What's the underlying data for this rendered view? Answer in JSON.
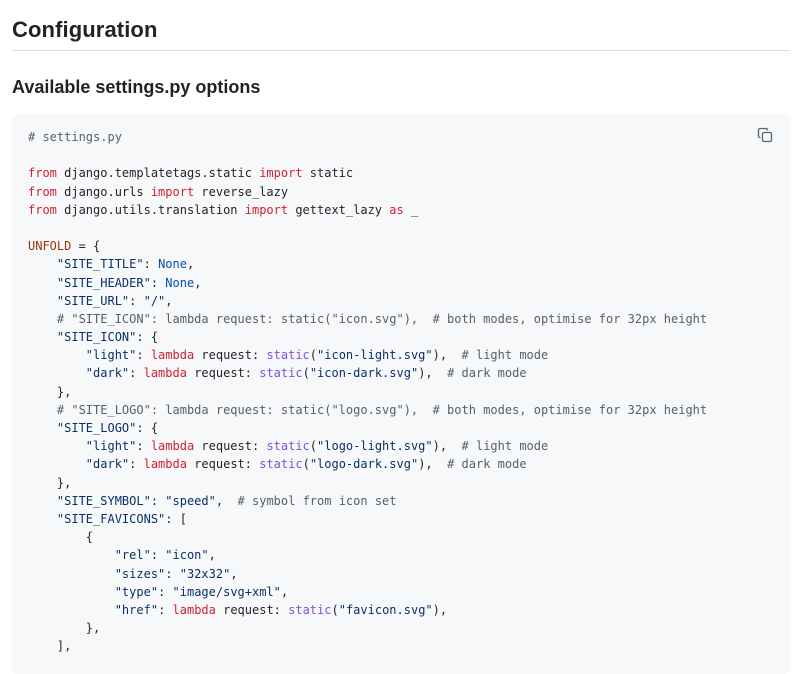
{
  "heading": "Configuration",
  "subheading": "Available settings.py options",
  "copy_icon": "copy-icon",
  "colors": {
    "keyword": "#cf222e",
    "string": "#0a3069",
    "comment": "#57606a",
    "constant": "#0550ae",
    "variable": "#953800",
    "function": "#8250df",
    "code_background": "#f6f8fa"
  },
  "code_lines": [
    [
      {
        "t": "# settings.py",
        "c": "com"
      }
    ],
    [],
    [
      {
        "t": "from",
        "c": "kw"
      },
      {
        "t": " django.templatetags.static "
      },
      {
        "t": "import",
        "c": "kw"
      },
      {
        "t": " static"
      }
    ],
    [
      {
        "t": "from",
        "c": "kw"
      },
      {
        "t": " django.urls "
      },
      {
        "t": "import",
        "c": "kw"
      },
      {
        "t": " reverse_lazy"
      }
    ],
    [
      {
        "t": "from",
        "c": "kw"
      },
      {
        "t": " django.utils.translation "
      },
      {
        "t": "import",
        "c": "kw"
      },
      {
        "t": " gettext_lazy "
      },
      {
        "t": "as",
        "c": "kw"
      },
      {
        "t": " _"
      }
    ],
    [],
    [
      {
        "t": "UNFOLD",
        "c": "var"
      },
      {
        "t": " = {"
      }
    ],
    [
      {
        "t": "    "
      },
      {
        "t": "\"SITE_TITLE\"",
        "c": "str"
      },
      {
        "t": ": "
      },
      {
        "t": "None",
        "c": "const"
      },
      {
        "t": ","
      }
    ],
    [
      {
        "t": "    "
      },
      {
        "t": "\"SITE_HEADER\"",
        "c": "str"
      },
      {
        "t": ": "
      },
      {
        "t": "None",
        "c": "const"
      },
      {
        "t": ","
      }
    ],
    [
      {
        "t": "    "
      },
      {
        "t": "\"SITE_URL\"",
        "c": "str"
      },
      {
        "t": ": "
      },
      {
        "t": "\"/\"",
        "c": "str"
      },
      {
        "t": ","
      }
    ],
    [
      {
        "t": "    "
      },
      {
        "t": "# \"SITE_ICON\": lambda request: static(\"icon.svg\"),  # both modes, optimise for 32px height",
        "c": "com"
      }
    ],
    [
      {
        "t": "    "
      },
      {
        "t": "\"SITE_ICON\"",
        "c": "str"
      },
      {
        "t": ": {"
      }
    ],
    [
      {
        "t": "        "
      },
      {
        "t": "\"light\"",
        "c": "str"
      },
      {
        "t": ": "
      },
      {
        "t": "lambda",
        "c": "kw"
      },
      {
        "t": " request: "
      },
      {
        "t": "static",
        "c": "fn"
      },
      {
        "t": "("
      },
      {
        "t": "\"icon-light.svg\"",
        "c": "str"
      },
      {
        "t": "),  "
      },
      {
        "t": "# light mode",
        "c": "com"
      }
    ],
    [
      {
        "t": "        "
      },
      {
        "t": "\"dark\"",
        "c": "str"
      },
      {
        "t": ": "
      },
      {
        "t": "lambda",
        "c": "kw"
      },
      {
        "t": " request: "
      },
      {
        "t": "static",
        "c": "fn"
      },
      {
        "t": "("
      },
      {
        "t": "\"icon-dark.svg\"",
        "c": "str"
      },
      {
        "t": "),  "
      },
      {
        "t": "# dark mode",
        "c": "com"
      }
    ],
    [
      {
        "t": "    },"
      }
    ],
    [
      {
        "t": "    "
      },
      {
        "t": "# \"SITE_LOGO\": lambda request: static(\"logo.svg\"),  # both modes, optimise for 32px height",
        "c": "com"
      }
    ],
    [
      {
        "t": "    "
      },
      {
        "t": "\"SITE_LOGO\"",
        "c": "str"
      },
      {
        "t": ": {"
      }
    ],
    [
      {
        "t": "        "
      },
      {
        "t": "\"light\"",
        "c": "str"
      },
      {
        "t": ": "
      },
      {
        "t": "lambda",
        "c": "kw"
      },
      {
        "t": " request: "
      },
      {
        "t": "static",
        "c": "fn"
      },
      {
        "t": "("
      },
      {
        "t": "\"logo-light.svg\"",
        "c": "str"
      },
      {
        "t": "),  "
      },
      {
        "t": "# light mode",
        "c": "com"
      }
    ],
    [
      {
        "t": "        "
      },
      {
        "t": "\"dark\"",
        "c": "str"
      },
      {
        "t": ": "
      },
      {
        "t": "lambda",
        "c": "kw"
      },
      {
        "t": " request: "
      },
      {
        "t": "static",
        "c": "fn"
      },
      {
        "t": "("
      },
      {
        "t": "\"logo-dark.svg\"",
        "c": "str"
      },
      {
        "t": "),  "
      },
      {
        "t": "# dark mode",
        "c": "com"
      }
    ],
    [
      {
        "t": "    },"
      }
    ],
    [
      {
        "t": "    "
      },
      {
        "t": "\"SITE_SYMBOL\"",
        "c": "str"
      },
      {
        "t": ": "
      },
      {
        "t": "\"speed\"",
        "c": "str"
      },
      {
        "t": ",  "
      },
      {
        "t": "# symbol from icon set",
        "c": "com"
      }
    ],
    [
      {
        "t": "    "
      },
      {
        "t": "\"SITE_FAVICONS\"",
        "c": "str"
      },
      {
        "t": ": ["
      }
    ],
    [
      {
        "t": "        {"
      }
    ],
    [
      {
        "t": "            "
      },
      {
        "t": "\"rel\"",
        "c": "str"
      },
      {
        "t": ": "
      },
      {
        "t": "\"icon\"",
        "c": "str"
      },
      {
        "t": ","
      }
    ],
    [
      {
        "t": "            "
      },
      {
        "t": "\"sizes\"",
        "c": "str"
      },
      {
        "t": ": "
      },
      {
        "t": "\"32x32\"",
        "c": "str"
      },
      {
        "t": ","
      }
    ],
    [
      {
        "t": "            "
      },
      {
        "t": "\"type\"",
        "c": "str"
      },
      {
        "t": ": "
      },
      {
        "t": "\"image/svg+xml\"",
        "c": "str"
      },
      {
        "t": ","
      }
    ],
    [
      {
        "t": "            "
      },
      {
        "t": "\"href\"",
        "c": "str"
      },
      {
        "t": ": "
      },
      {
        "t": "lambda",
        "c": "kw"
      },
      {
        "t": " request: "
      },
      {
        "t": "static",
        "c": "fn"
      },
      {
        "t": "("
      },
      {
        "t": "\"favicon.svg\"",
        "c": "str"
      },
      {
        "t": "),"
      }
    ],
    [
      {
        "t": "        },"
      }
    ],
    [
      {
        "t": "    ],"
      }
    ]
  ]
}
